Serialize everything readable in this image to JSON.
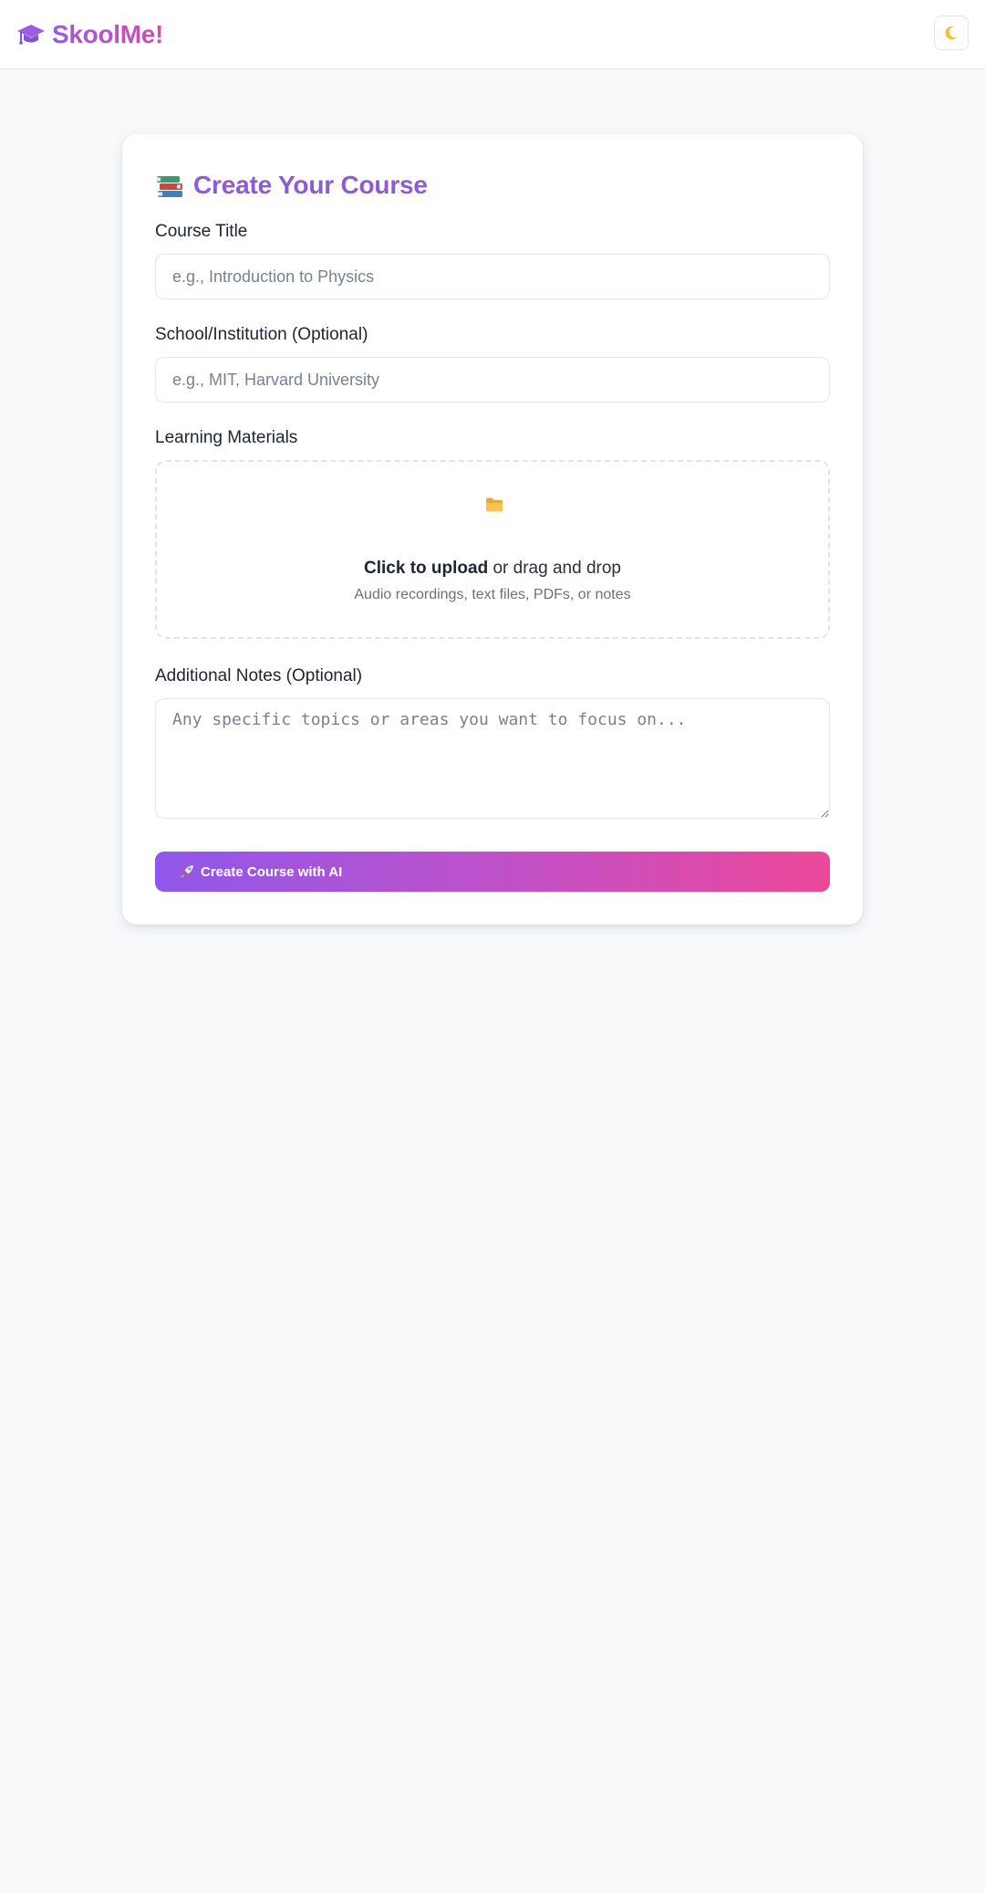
{
  "app": {
    "name": "SkoolMe!",
    "brand_gradient": [
      "#9b59e0",
      "#d14fa8"
    ],
    "logo_icon": "graduation-cap-icon",
    "theme_toggle_icon": "moon-icon"
  },
  "form": {
    "title": "Create Your Course",
    "title_icon": "books-icon",
    "title_color": "#8e5bd3",
    "course_title": {
      "label": "Course Title",
      "placeholder": "e.g., Introduction to Physics",
      "value": ""
    },
    "school": {
      "label": "School/Institution (Optional)",
      "placeholder": "e.g., MIT, Harvard University",
      "value": ""
    },
    "materials": {
      "label": "Learning Materials",
      "icon": "folder-icon",
      "upload_strong": "Click to upload",
      "upload_rest": " or drag and drop",
      "hint": "Audio recordings, text files, PDFs, or notes"
    },
    "notes": {
      "label": "Additional Notes (Optional)",
      "placeholder": "Any specific topics or areas you want to focus on...",
      "value": ""
    },
    "submit": {
      "icon": "rocket-icon",
      "label": "Create Course with AI",
      "gradient": [
        "#8f58ea",
        "#ec4899"
      ]
    }
  }
}
